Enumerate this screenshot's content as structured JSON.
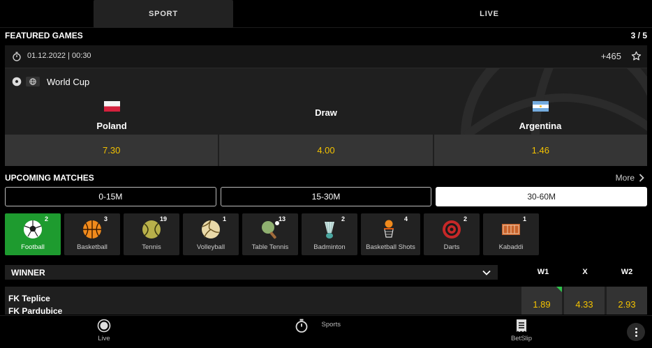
{
  "topnav": {
    "sport": "SPORT",
    "live": "LIVE"
  },
  "featured": {
    "title": "FEATURED GAMES",
    "counter": "3 / 5",
    "date": "01.12.2022 | 00:30",
    "more_markets": "+465",
    "league": "World Cup",
    "home": "Poland",
    "draw": "Draw",
    "away": "Argentina",
    "odds": [
      "7.30",
      "4.00",
      "1.46"
    ]
  },
  "upcoming": {
    "title": "UPCOMING MATCHES",
    "more": "More",
    "time_filters": [
      "0-15M",
      "15-30M",
      "30-60M"
    ],
    "active_filter": "30-60M"
  },
  "sports": [
    {
      "label": "Football",
      "count": "2",
      "icon": "football-icon"
    },
    {
      "label": "Basketball",
      "count": "3",
      "icon": "basketball-icon"
    },
    {
      "label": "Tennis",
      "count": "19",
      "icon": "tennis-icon"
    },
    {
      "label": "Volleyball",
      "count": "1",
      "icon": "volleyball-icon"
    },
    {
      "label": "Table Tennis",
      "count": "13",
      "icon": "table-tennis-icon"
    },
    {
      "label": "Badminton",
      "count": "2",
      "icon": "badminton-icon"
    },
    {
      "label": "Basketball Shots",
      "count": "4",
      "icon": "basketball-shots-icon"
    },
    {
      "label": "Darts",
      "count": "2",
      "icon": "darts-icon"
    },
    {
      "label": "Kabaddi",
      "count": "1",
      "icon": "kabaddi-icon"
    }
  ],
  "market": {
    "name": "WINNER",
    "cols": [
      "W1",
      "X",
      "W2"
    ]
  },
  "match": {
    "team1": "FK Teplice",
    "team2": "FK Pardubice",
    "odds": [
      "1.89",
      "4.33",
      "2.93"
    ]
  },
  "bottomnav": {
    "live": "Live",
    "sports": "Sports",
    "betslip": "BetSlip"
  },
  "colors": {
    "accent_odds": "#f3c200",
    "active_sport": "#1e9b2f",
    "card_bg": "#1f1f1f"
  }
}
